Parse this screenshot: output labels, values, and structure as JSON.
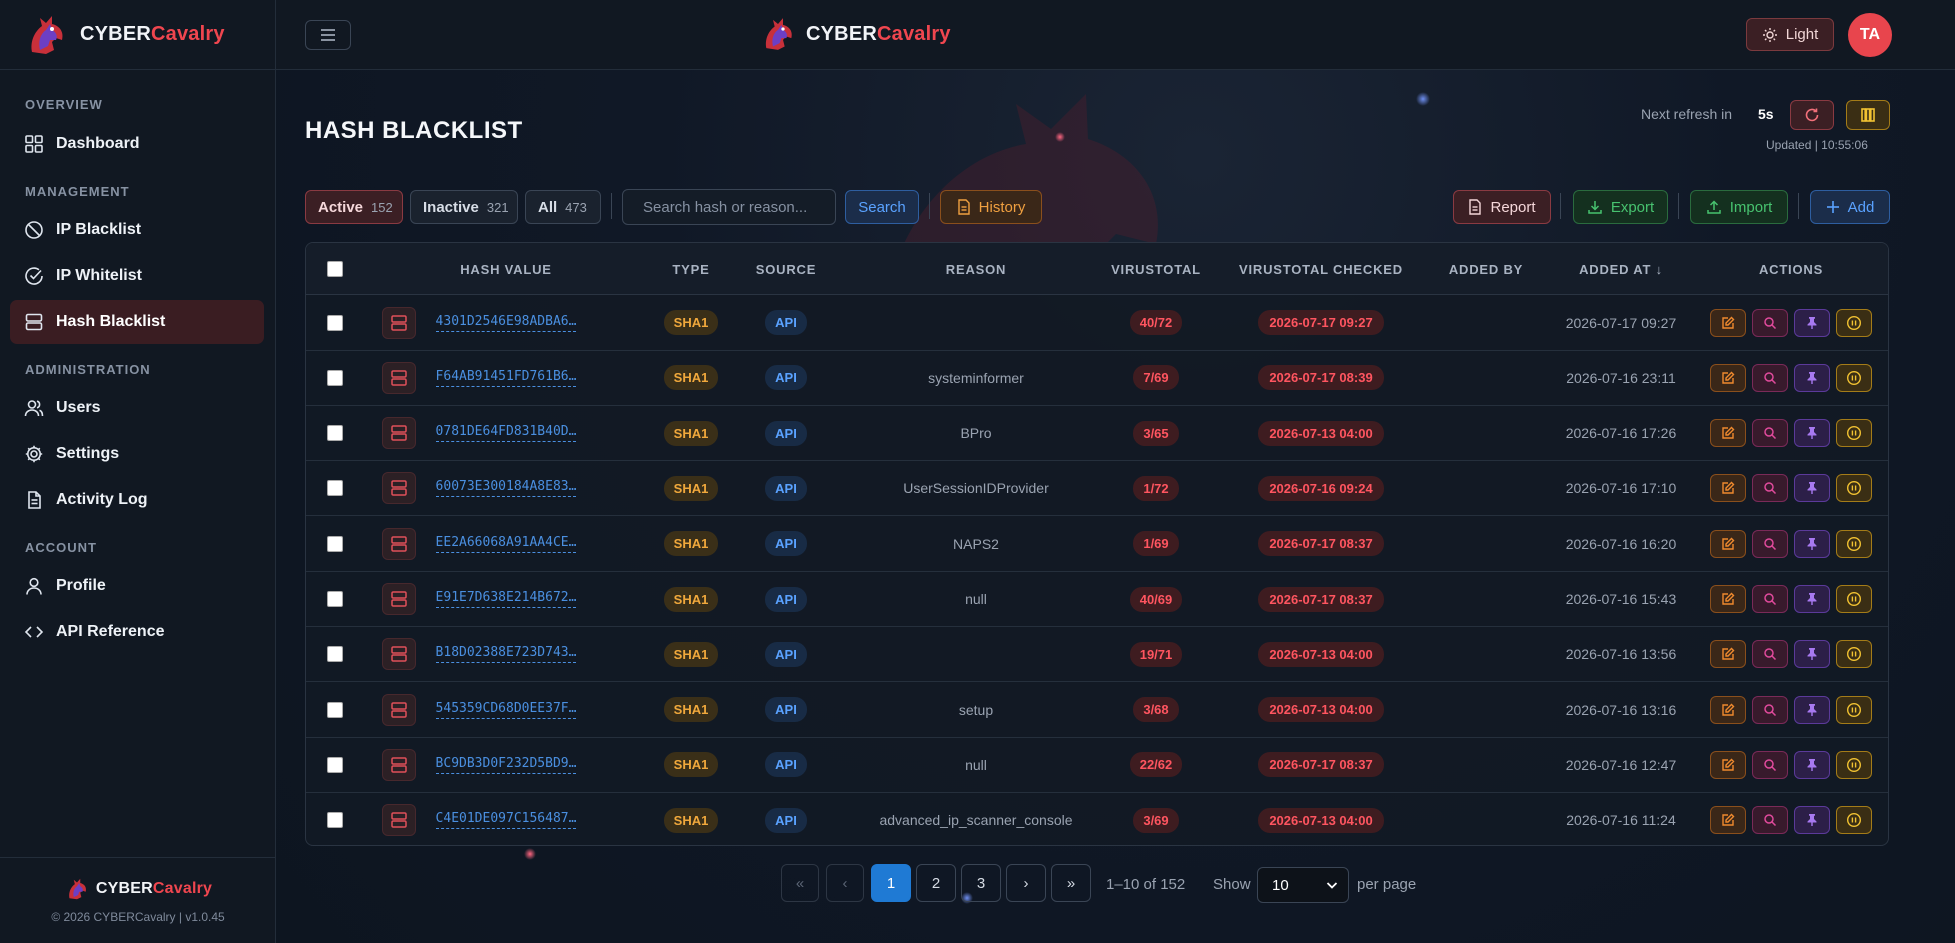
{
  "brand": {
    "part1": "CYBER",
    "part2": "Cavalry"
  },
  "sidebar": {
    "sections": [
      {
        "title": "OVERVIEW",
        "items": [
          {
            "label": "Dashboard",
            "icon": "grid-icon",
            "active": false
          }
        ]
      },
      {
        "title": "MANAGEMENT",
        "items": [
          {
            "label": "IP Blacklist",
            "icon": "ban-icon",
            "active": false
          },
          {
            "label": "IP Whitelist",
            "icon": "check-circle-icon",
            "active": false
          },
          {
            "label": "Hash Blacklist",
            "icon": "server-icon",
            "active": true
          }
        ]
      },
      {
        "title": "ADMINISTRATION",
        "items": [
          {
            "label": "Users",
            "icon": "users-icon",
            "active": false
          },
          {
            "label": "Settings",
            "icon": "gear-icon",
            "active": false
          },
          {
            "label": "Activity Log",
            "icon": "document-icon",
            "active": false
          }
        ]
      },
      {
        "title": "ACCOUNT",
        "items": [
          {
            "label": "Profile",
            "icon": "user-icon",
            "active": false
          },
          {
            "label": "API Reference",
            "icon": "code-icon",
            "active": false
          }
        ]
      }
    ],
    "footer": {
      "copyright": "© 2026 CYBERCavalry | v1.0.45"
    }
  },
  "topbar": {
    "theme_label": "Light",
    "avatar_initials": "TA"
  },
  "page": {
    "title": "HASH BLACKLIST",
    "refresh_label": "Next refresh in",
    "refresh_value": "5s",
    "updated": "Updated | 10:55:06"
  },
  "filters": {
    "active": {
      "label": "Active",
      "count": "152"
    },
    "inactive": {
      "label": "Inactive",
      "count": "321"
    },
    "all": {
      "label": "All",
      "count": "473"
    }
  },
  "search": {
    "placeholder": "Search hash or reason...",
    "button": "Search"
  },
  "toolbar": {
    "history": "History",
    "report": "Report",
    "export": "Export",
    "import": "Import",
    "add": "Add"
  },
  "table": {
    "headers": [
      "HASH VALUE",
      "TYPE",
      "SOURCE",
      "REASON",
      "VIRUSTOTAL",
      "VIRUSTOTAL CHECKED",
      "ADDED BY",
      "ADDED AT ↓",
      "ACTIONS"
    ],
    "rows": [
      {
        "hash": "4301D2546E98ADBA6…",
        "type": "SHA1",
        "source": "API",
        "reason": "",
        "vt": "40/72",
        "checked": "2026-07-17 09:27",
        "added_by": "",
        "added_at": "2026-07-17 09:27"
      },
      {
        "hash": "F64AB91451FD761B6…",
        "type": "SHA1",
        "source": "API",
        "reason": "systeminformer",
        "vt": "7/69",
        "checked": "2026-07-17 08:39",
        "added_by": "",
        "added_at": "2026-07-16 23:11"
      },
      {
        "hash": "0781DE64FD831B40D…",
        "type": "SHA1",
        "source": "API",
        "reason": "BPro",
        "vt": "3/65",
        "checked": "2026-07-13 04:00",
        "added_by": "",
        "added_at": "2026-07-16 17:26"
      },
      {
        "hash": "60073E300184A8E83…",
        "type": "SHA1",
        "source": "API",
        "reason": "UserSessionIDProvider",
        "vt": "1/72",
        "checked": "2026-07-16 09:24",
        "added_by": "",
        "added_at": "2026-07-16 17:10"
      },
      {
        "hash": "EE2A66068A91AA4CE…",
        "type": "SHA1",
        "source": "API",
        "reason": "NAPS2",
        "vt": "1/69",
        "checked": "2026-07-17 08:37",
        "added_by": "",
        "added_at": "2026-07-16 16:20"
      },
      {
        "hash": "E91E7D638E214B672…",
        "type": "SHA1",
        "source": "API",
        "reason": "null",
        "vt": "40/69",
        "checked": "2026-07-17 08:37",
        "added_by": "",
        "added_at": "2026-07-16 15:43"
      },
      {
        "hash": "B18D02388E723D743…",
        "type": "SHA1",
        "source": "API",
        "reason": "",
        "vt": "19/71",
        "checked": "2026-07-13 04:00",
        "added_by": "",
        "added_at": "2026-07-16 13:56"
      },
      {
        "hash": "545359CD68D0EE37F…",
        "type": "SHA1",
        "source": "API",
        "reason": "setup",
        "vt": "3/68",
        "checked": "2026-07-13 04:00",
        "added_by": "",
        "added_at": "2026-07-16 13:16"
      },
      {
        "hash": "BC9DB3D0F232D5BD9…",
        "type": "SHA1",
        "source": "API",
        "reason": "null",
        "vt": "22/62",
        "checked": "2026-07-17 08:37",
        "added_by": "",
        "added_at": "2026-07-16 12:47"
      },
      {
        "hash": "C4E01DE097C156487…",
        "type": "SHA1",
        "source": "API",
        "reason": "advanced_ip_scanner_console",
        "vt": "3/69",
        "checked": "2026-07-13 04:00",
        "added_by": "",
        "added_at": "2026-07-16 11:24"
      }
    ]
  },
  "pagination": {
    "first": "«",
    "prev": "‹",
    "pages": [
      "1",
      "2",
      "3"
    ],
    "current": "1",
    "next": "›",
    "last": "»",
    "info": "1–10 of 152",
    "show_label": "Show",
    "per_page_value": "10",
    "per_page_suffix": "per page"
  },
  "colors": {
    "accent": "#f0464f",
    "primary": "#1f7ad4",
    "sha_badge": "#f0a83c",
    "api_badge": "#5aa2ff",
    "danger": "#ff5560"
  }
}
